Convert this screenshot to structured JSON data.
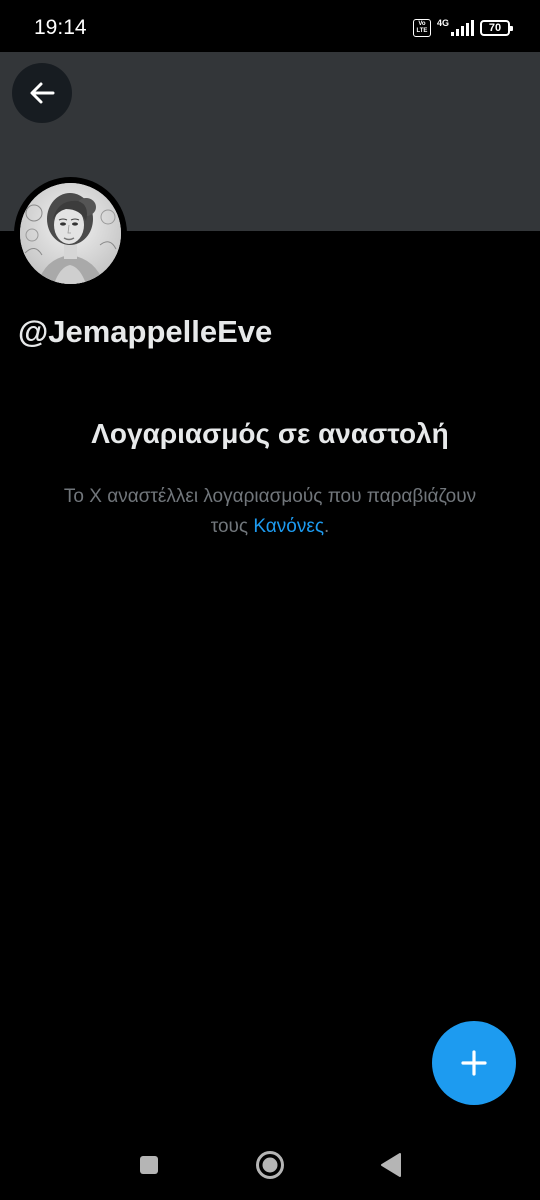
{
  "status_bar": {
    "time": "19:14",
    "volte": "Vo LTE",
    "network": "4G",
    "battery": "70"
  },
  "profile": {
    "handle": "@JemappelleEve"
  },
  "suspension": {
    "title": "Λογαριασμός σε αναστολή",
    "description": "Το X αναστέλλει λογαριασμούς που παραβιάζουν τους",
    "link_text": "Κανόνες",
    "trailing": "."
  },
  "colors": {
    "background": "#000000",
    "banner": "#333639",
    "accent": "#1d9bf0",
    "primary_text": "#e7e9ea",
    "secondary_text": "#71767b"
  },
  "icons": {
    "back": "arrow-left-icon",
    "compose": "plus-icon",
    "nav_recents": "square-icon",
    "nav_home": "circle-icon",
    "nav_back": "triangle-icon"
  }
}
